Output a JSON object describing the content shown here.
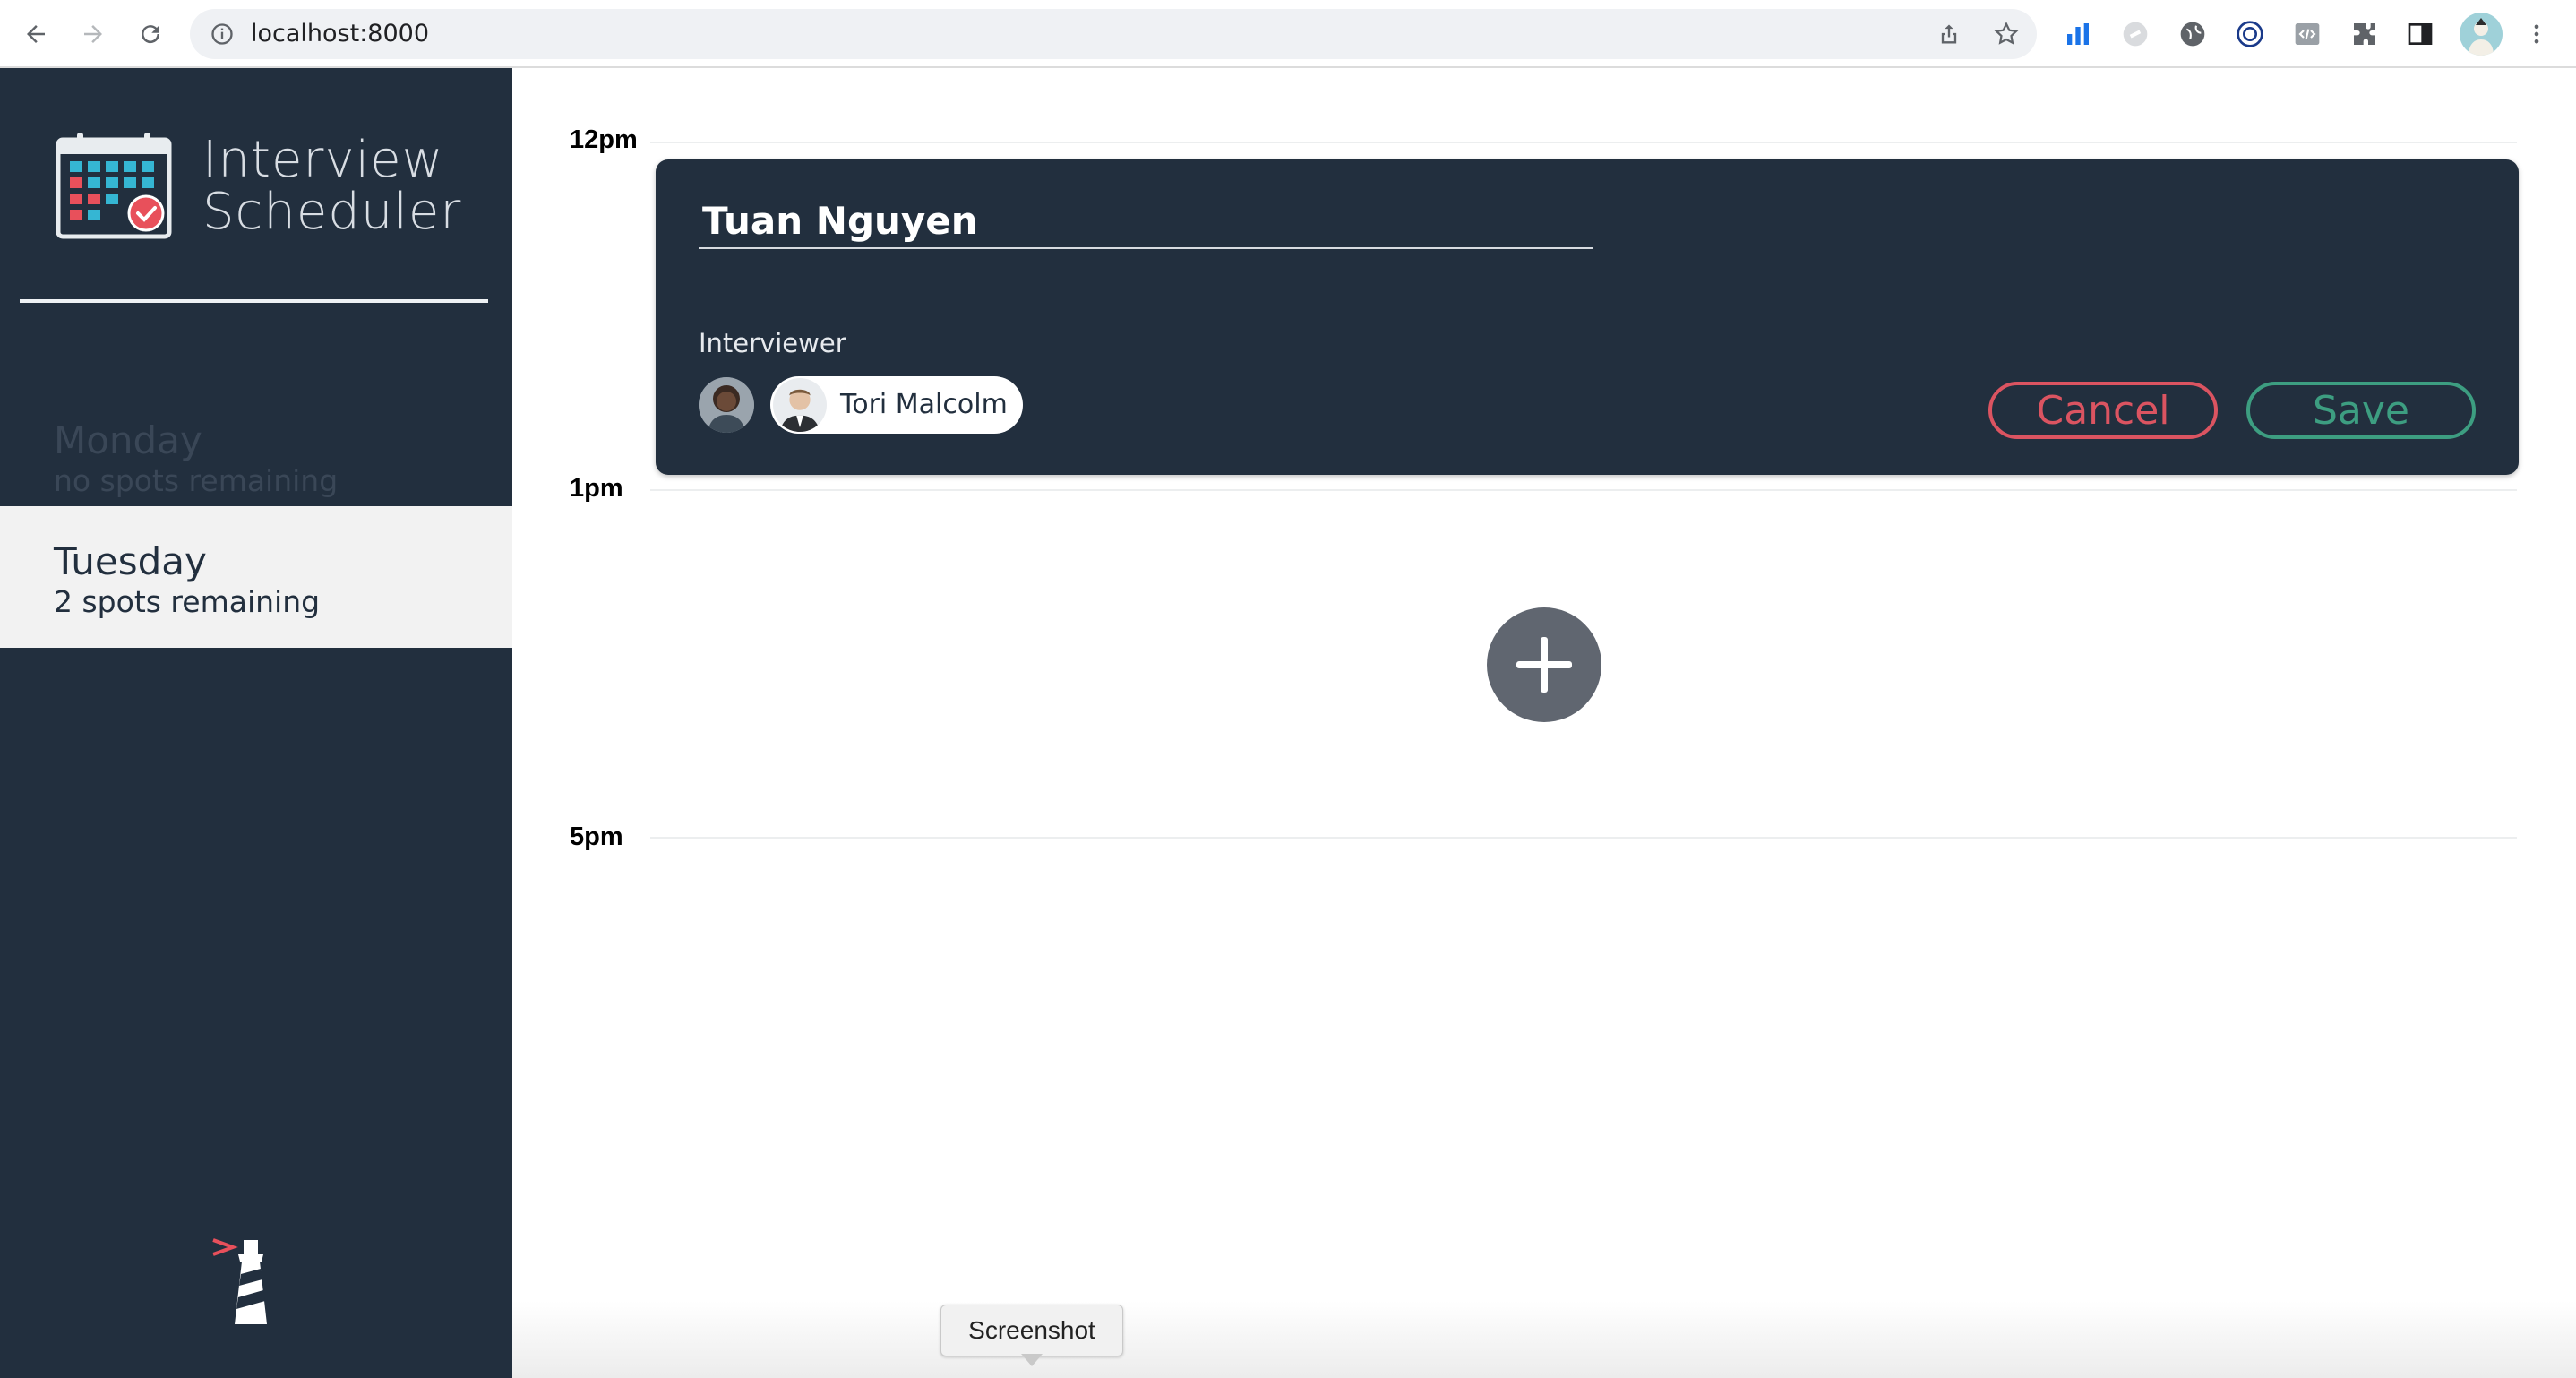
{
  "browser": {
    "url": "localhost:8000",
    "icons": [
      "back-icon",
      "forward-icon",
      "reload-icon",
      "site-info-icon",
      "share-icon",
      "bookmark-star-icon",
      "extensions-icon",
      "side-panel-icon",
      "profile-avatar",
      "menu-icon"
    ]
  },
  "sidebar": {
    "logo_line1": "Interview",
    "logo_line2": "Scheduler",
    "days": [
      {
        "name": "Monday",
        "spots": "no spots remaining",
        "selected": false
      },
      {
        "name": "Tuesday",
        "spots": "2 spots remaining",
        "selected": true
      }
    ]
  },
  "schedule": {
    "times": [
      "12pm",
      "1pm",
      "5pm"
    ],
    "form": {
      "student_name": "Tuan Nguyen",
      "interviewer_label": "Interviewer",
      "selected_interviewer": "Tori Malcolm",
      "cancel_label": "Cancel",
      "save_label": "Save"
    }
  },
  "tooltip": "Screenshot",
  "colors": {
    "sidebar_bg": "#222f3e",
    "cancel": "#db5461",
    "save": "#3d9e81",
    "add_button": "#606670"
  }
}
